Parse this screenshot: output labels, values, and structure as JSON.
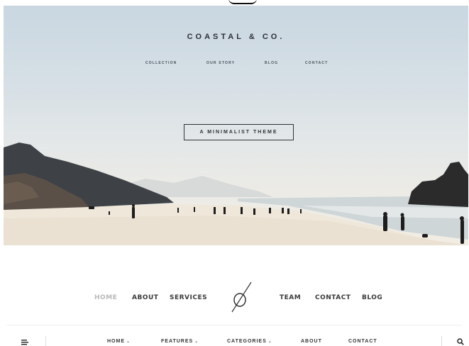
{
  "hero": {
    "brand": "COASTAL & CO.",
    "nav": [
      "COLLECTION",
      "OUR STORY",
      "BLOG",
      "CONTACT"
    ],
    "badge": "A MINIMALIST THEME"
  },
  "nav2": {
    "items_left": [
      "HOME",
      "ABOUT",
      "SERVICES"
    ],
    "items_right": [
      "TEAM",
      "CONTACT",
      "BLOG"
    ],
    "active": "HOME"
  },
  "nav3": {
    "items": [
      {
        "label": "HOME",
        "caret": "⌄"
      },
      {
        "label": "FEATURES",
        "caret": "⌄"
      },
      {
        "label": "CATEGORIES",
        "caret": "⌄"
      },
      {
        "label": "ABOUT",
        "caret": ""
      },
      {
        "label": "CONTACT",
        "caret": ""
      }
    ],
    "menu_icon": "menu-icon",
    "search_icon": "search-icon"
  },
  "colors": {
    "text_dark": "#2c3036",
    "active_muted": "#b8b8b8",
    "sand": "#efe7da",
    "sea": "#cfd8dc"
  }
}
